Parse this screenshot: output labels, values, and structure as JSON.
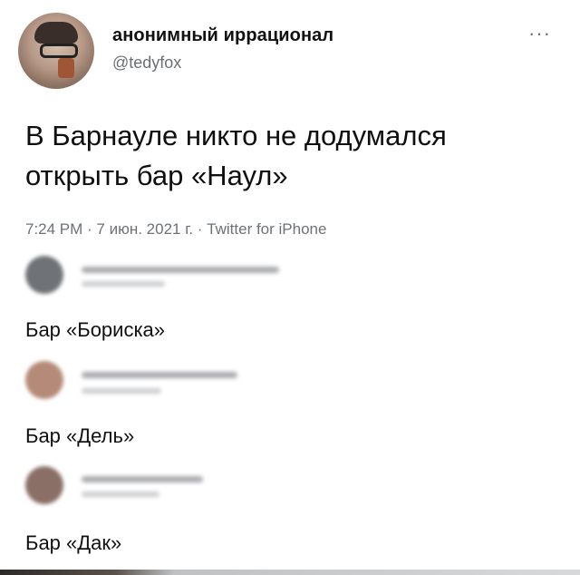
{
  "author": {
    "display_name": "анонимный иррационал",
    "handle": "@tedyfox"
  },
  "menu": {
    "more_label": "···"
  },
  "tweet": {
    "lines": [
      "В Барнауле никто не додумался",
      "открыть бар «Наул»"
    ],
    "meta": "7:24 PM · 7 июн. 2021 г. · Twitter for iPhone"
  },
  "replies": [
    {
      "text": "Бар «Бориска»",
      "avatar_color": "#6f7276"
    },
    {
      "text": "Бар «Дель»",
      "avatar_color": "#b58a78"
    },
    {
      "text": "Бар «Дак»",
      "avatar_color": "#8a6f66"
    }
  ],
  "colors": {
    "secondary_text": "#6d7278",
    "background": "#ffffff"
  }
}
